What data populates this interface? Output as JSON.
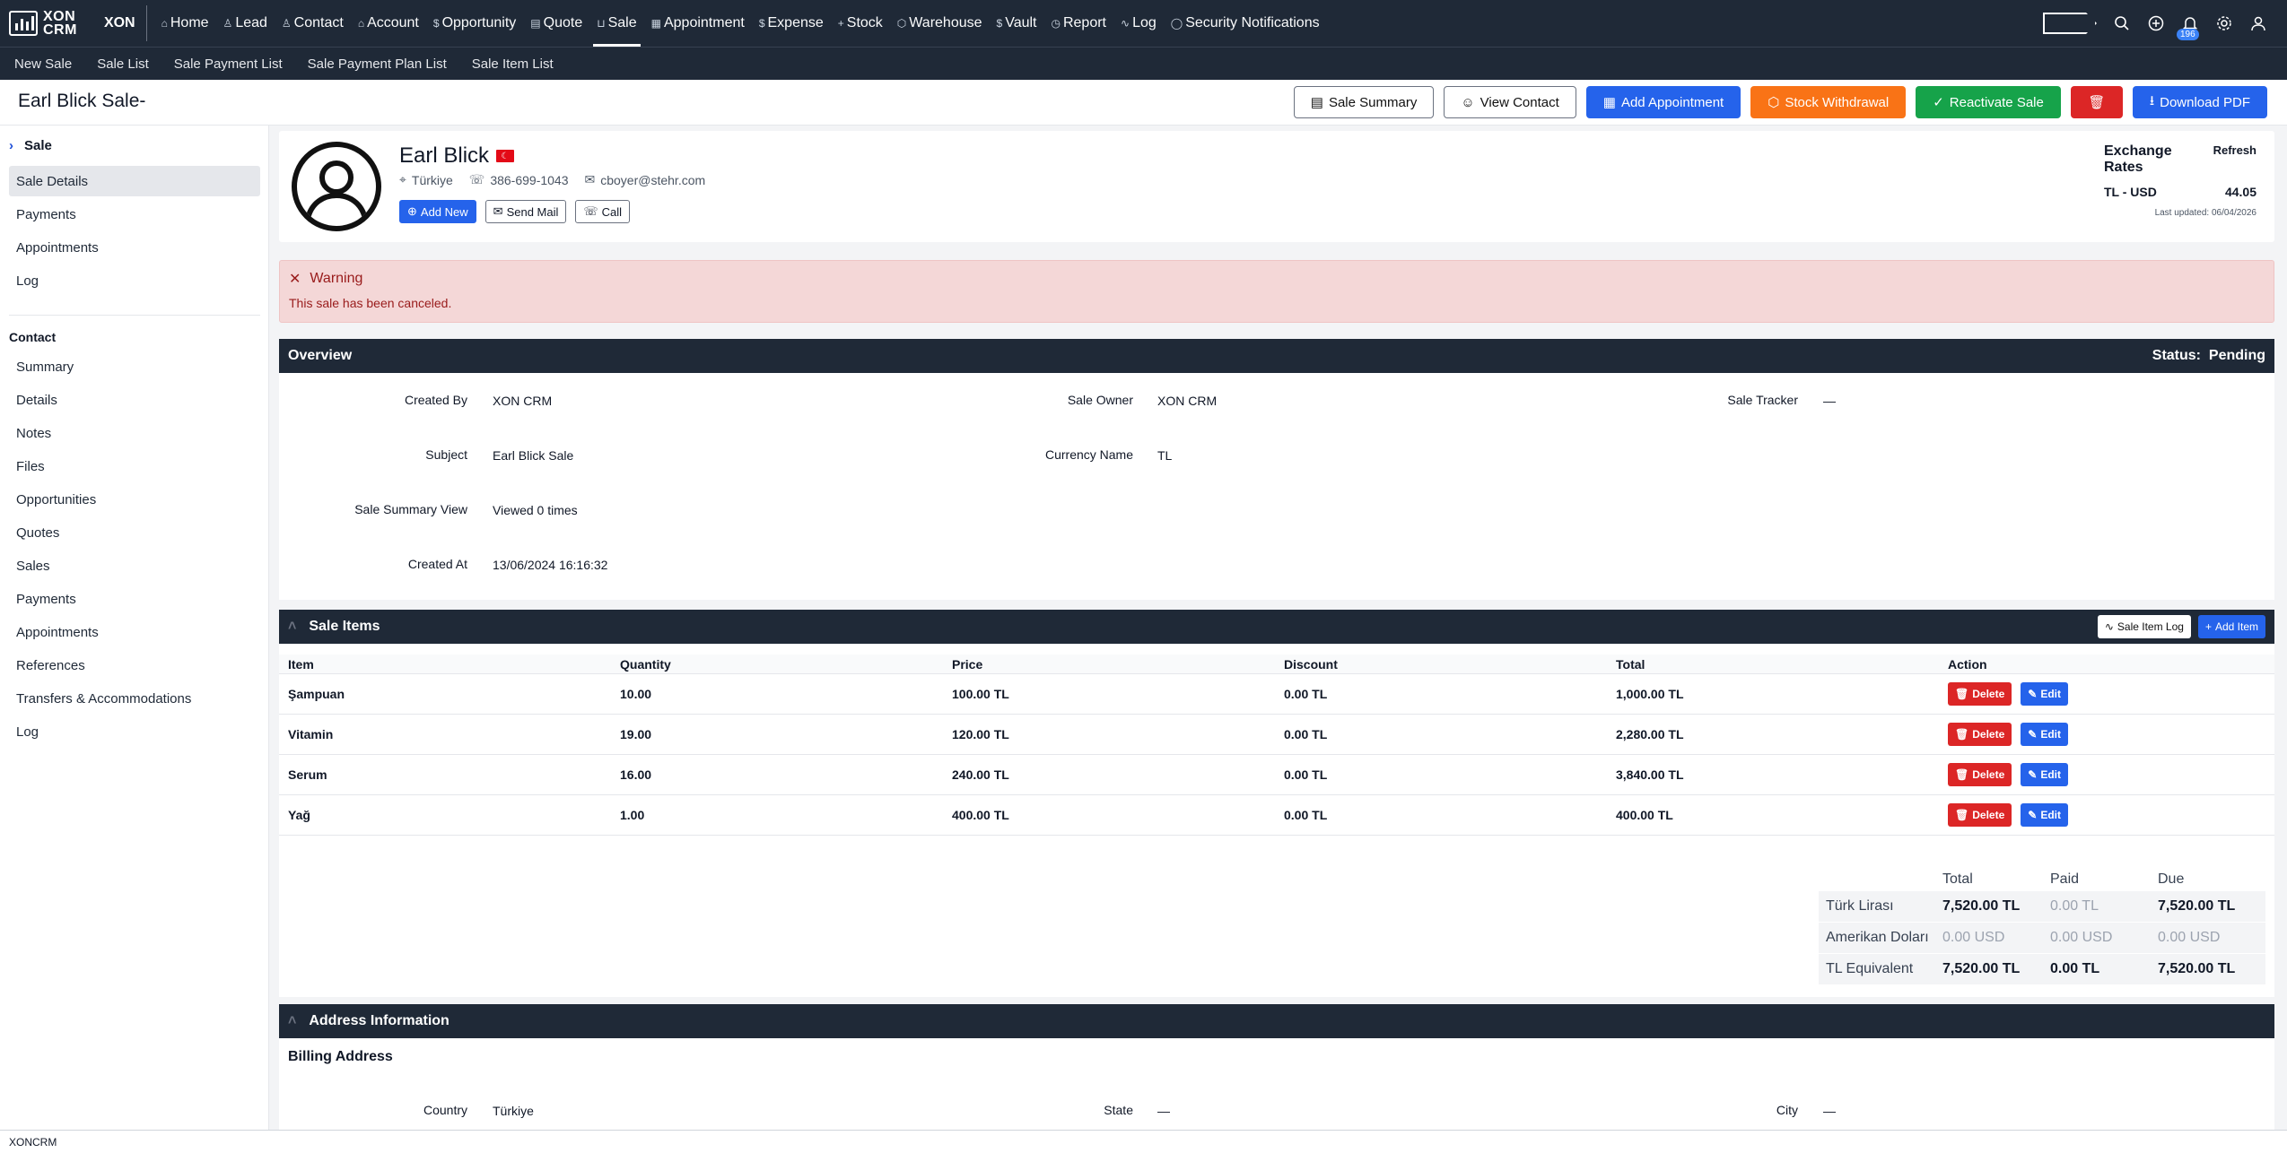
{
  "brand": {
    "logo_text_1": "XON",
    "logo_text_2": "CRM",
    "org": "XON"
  },
  "nav": [
    {
      "label": "Home",
      "icon": "home-icon"
    },
    {
      "label": "Lead",
      "icon": "user-icon"
    },
    {
      "label": "Contact",
      "icon": "contact-icon"
    },
    {
      "label": "Account",
      "icon": "bank-icon"
    },
    {
      "label": "Opportunity",
      "icon": "dollar-icon"
    },
    {
      "label": "Quote",
      "icon": "document-icon"
    },
    {
      "label": "Sale",
      "icon": "cart-icon",
      "active": true
    },
    {
      "label": "Appointment",
      "icon": "calendar-icon"
    },
    {
      "label": "Expense",
      "icon": "dollar-icon"
    },
    {
      "label": "Stock",
      "icon": "plus-icon"
    },
    {
      "label": "Warehouse",
      "icon": "box-icon"
    },
    {
      "label": "Vault",
      "icon": "dollar-icon"
    },
    {
      "label": "Report",
      "icon": "clock-icon"
    },
    {
      "label": "Log",
      "icon": "activity-icon"
    },
    {
      "label": "Security Notifications",
      "icon": "shield-icon"
    }
  ],
  "notifications_count": "196",
  "subnav": [
    "New Sale",
    "Sale List",
    "Sale Payment List",
    "Sale Payment Plan List",
    "Sale Item List"
  ],
  "page_title": "Earl Blick Sale-",
  "actions": {
    "sale_summary": "Sale Summary",
    "view_contact": "View Contact",
    "add_appointment": "Add Appointment",
    "stock_withdrawal": "Stock Withdrawal",
    "reactivate_sale": "Reactivate Sale",
    "download_pdf": "Download PDF"
  },
  "sidebar": {
    "section": "Sale",
    "sale_items": [
      "Sale Details",
      "Payments",
      "Appointments",
      "Log"
    ],
    "contact_label": "Contact",
    "contact_items": [
      "Summary",
      "Details",
      "Notes",
      "Files",
      "Opportunities",
      "Quotes",
      "Sales",
      "Payments",
      "Appointments",
      "References",
      "Transfers & Accommodations",
      "Log"
    ]
  },
  "contact": {
    "name": "Earl Blick",
    "country": "Türkiye",
    "phone": "386-699-1043",
    "email": "cboyer@stehr.com",
    "add_new": "Add New",
    "send_mail": "Send Mail",
    "call": "Call"
  },
  "exchange": {
    "title": "Exchange Rates",
    "refresh": "Refresh",
    "pair": "TL - USD",
    "rate": "44.05",
    "updated": "Last updated: 06/04/2026"
  },
  "warning": {
    "title": "Warning",
    "message": "This sale has been canceled."
  },
  "overview": {
    "title": "Overview",
    "status_label": "Status:",
    "status": "Pending",
    "created_by_label": "Created By",
    "created_by": "XON CRM",
    "sale_owner_label": "Sale Owner",
    "sale_owner": "XON CRM",
    "sale_tracker_label": "Sale Tracker",
    "sale_tracker": "—",
    "subject_label": "Subject",
    "subject": "Earl Blick Sale",
    "currency_label": "Currency Name",
    "currency": "TL",
    "summary_view_label": "Sale Summary View",
    "summary_view": "Viewed 0 times",
    "created_at_label": "Created At",
    "created_at": "13/06/2024 16:16:32"
  },
  "items": {
    "title": "Sale Items",
    "log_btn": "Sale Item Log",
    "add_btn": "Add Item",
    "headers": [
      "Item",
      "Quantity",
      "Price",
      "Discount",
      "Total",
      "Action"
    ],
    "rows": [
      {
        "item": "Şampuan",
        "qty": "10.00",
        "price": "100.00 TL",
        "discount": "0.00 TL",
        "total": "1,000.00 TL"
      },
      {
        "item": "Vitamin",
        "qty": "19.00",
        "price": "120.00 TL",
        "discount": "0.00 TL",
        "total": "2,280.00 TL"
      },
      {
        "item": "Serum",
        "qty": "16.00",
        "price": "240.00 TL",
        "discount": "0.00 TL",
        "total": "3,840.00 TL"
      },
      {
        "item": "Yağ",
        "qty": "1.00",
        "price": "400.00 TL",
        "discount": "0.00 TL",
        "total": "400.00 TL"
      }
    ],
    "delete": "Delete",
    "edit": "Edit"
  },
  "totals": {
    "headers": [
      "Total",
      "Paid",
      "Due"
    ],
    "rows": [
      {
        "label": "Türk Lirası",
        "total": "7,520.00 TL",
        "paid": "0.00 TL",
        "due": "7,520.00 TL"
      },
      {
        "label": "Amerikan Doları",
        "total": "0.00 USD",
        "paid": "0.00 USD",
        "due": "0.00 USD"
      },
      {
        "label": "TL Equivalent",
        "total": "7,520.00 TL",
        "paid": "0.00 TL",
        "due": "7,520.00 TL"
      }
    ]
  },
  "address": {
    "title": "Address Information",
    "billing": "Billing Address",
    "country_label": "Country",
    "country": "Türkiye",
    "state_label": "State",
    "state": "—",
    "city_label": "City",
    "city": "—"
  },
  "footer": "XONCRM"
}
